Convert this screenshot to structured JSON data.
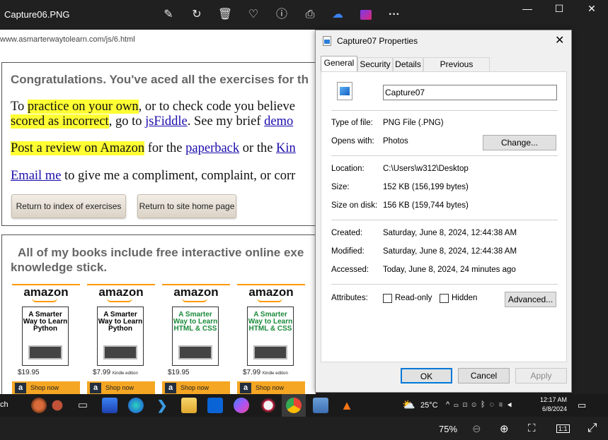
{
  "viewer": {
    "title": "Capture06.PNG",
    "toolbar_icons": [
      "edit-icon",
      "rotate-icon",
      "delete-icon",
      "favorite-icon",
      "info-icon",
      "print-icon",
      "onedrive-icon",
      "clipchamp-icon",
      "more-icon"
    ],
    "minimize": "—",
    "maximize": "☐",
    "close": "✕",
    "zoom": "75%"
  },
  "page": {
    "url": "www.asmarterwaytolearn.com/js/6.html",
    "heading": "Congratulations. You've aced all the exercises for th",
    "p1_a": "To ",
    "p1_hl": "practice on your own",
    "p1_b": ", or to check code you believe",
    "p1_line2_hl": "scored as incorrect",
    "p1_line2_a": ", go to ",
    "p1_line2_link": "jsFiddle",
    "p1_line2_b": ". See my brief ",
    "p1_line2_link2": "demo",
    "p2_hl": "Post a review on Amazon",
    "p2_a": " for the ",
    "p2_link": "paperback",
    "p2_b": " or the ",
    "p2_link2": "Kin",
    "p3_link": "Email me",
    "p3_a": " to give me a compliment, complaint, or corr",
    "btn_index": "Return to index of exercises",
    "btn_home": "Return to site home page",
    "books_heading_1": "All of my books include free interactive online exe",
    "books_heading_2": "knowledge stick.",
    "books": [
      {
        "brand": "amazon",
        "cover": "A Smarter Way to Learn Python",
        "price": "$19.95",
        "edition": "",
        "shop": "Shop now"
      },
      {
        "brand": "amazon",
        "cover": "A Smarter Way to Learn Python",
        "price": "$7.99",
        "edition": "Kindle edition",
        "shop": "Shop now"
      },
      {
        "brand": "amazon",
        "cover": "A Smarter Way to Learn HTML & CSS",
        "price": "$19.95",
        "edition": "",
        "shop": "Shop now"
      },
      {
        "brand": "amazon",
        "cover": "A Smarter Way to Learn HTML & CSS",
        "price": "$7.99",
        "edition": "Kindle edition",
        "shop": "Shop now"
      }
    ]
  },
  "dialog": {
    "title": "Capture07 Properties",
    "tabs": [
      "General",
      "Security",
      "Details",
      "Previous Versions"
    ],
    "filename": "Capture07",
    "type_label": "Type of file:",
    "type_value": "PNG File (.PNG)",
    "opens_label": "Opens with:",
    "opens_value": "Photos",
    "change_btn": "Change...",
    "location_label": "Location:",
    "location_value": "C:\\Users\\w312\\Desktop",
    "size_label": "Size:",
    "size_value": "152 KB (156,199 bytes)",
    "size_disk_label": "Size on disk:",
    "size_disk_value": "156 KB (159,744 bytes)",
    "created_label": "Created:",
    "created_value": "Saturday, June 8, 2024, 12:44:38 AM",
    "modified_label": "Modified:",
    "modified_value": "Saturday, June 8, 2024, 12:44:38 AM",
    "accessed_label": "Accessed:",
    "accessed_value": "Today, June 8, 2024, 24 minutes ago",
    "attributes_label": "Attributes:",
    "readonly_label": "Read-only",
    "hidden_label": "Hidden",
    "advanced_btn": "Advanced...",
    "ok": "OK",
    "cancel": "Cancel",
    "apply": "Apply"
  },
  "taskbar": {
    "search_partial": "ch",
    "weather": "25°C",
    "time": "12:17 AM",
    "date": "6/8/2024"
  }
}
